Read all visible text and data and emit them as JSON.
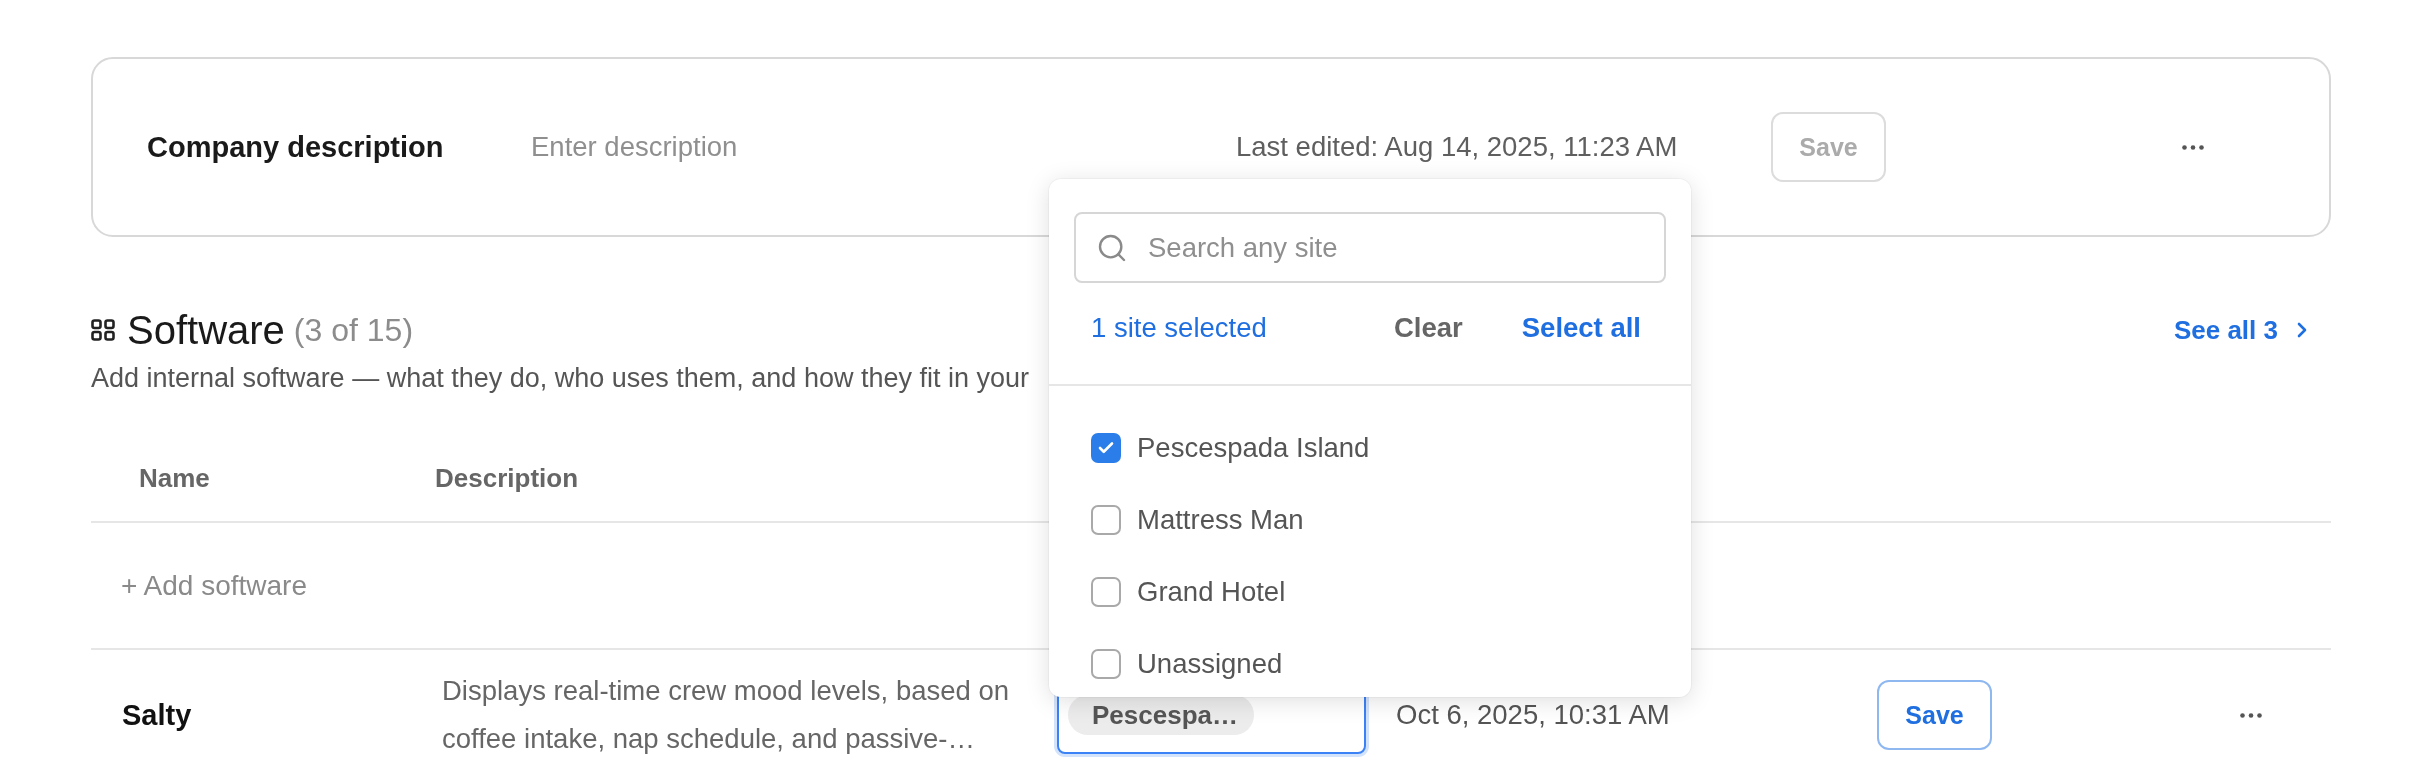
{
  "company_description": {
    "label": "Company description",
    "placeholder": "Enter description",
    "last_edited": "Last edited: Aug 14, 2025, 11:23 AM",
    "save_button": {
      "label": "Save",
      "disabled": true
    }
  },
  "software": {
    "title": "Software",
    "count": "(3 of 15)",
    "description": "Add internal software — what they do, who uses them, and how they fit in your",
    "see_all": "See all 3"
  },
  "table": {
    "columns": [
      "Name",
      "Description"
    ],
    "add_button": "+ Add software",
    "rows": [
      {
        "name": "Salty",
        "description": "Displays real-time crew mood levels, based on coffee intake, nap schedule, and passive-…",
        "site_field": {
          "chip": "Pescespa…",
          "focused": true
        },
        "date": "Oct 6, 2025, 10:31 AM",
        "save_button": {
          "label": "Save",
          "disabled": false
        }
      }
    ]
  },
  "site_dropdown": {
    "search": {
      "placeholder": "Search any site"
    },
    "summary": "1 site selected",
    "clear": "Clear",
    "select_all": "Select all",
    "options": [
      {
        "label": "Pescespada Island",
        "checked": true
      },
      {
        "label": "Mattress Man",
        "checked": false
      },
      {
        "label": "Grand Hotel",
        "checked": false
      },
      {
        "label": "Unassigned",
        "checked": false
      }
    ]
  }
}
